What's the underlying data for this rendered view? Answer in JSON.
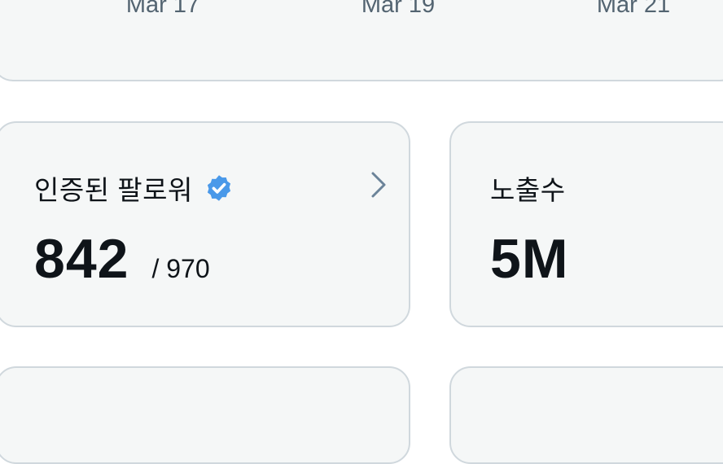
{
  "chart": {
    "x_ticks": [
      "Mar 17",
      "Mar 19",
      "Mar 21"
    ]
  },
  "verified_followers": {
    "label": "인증된 팔로워",
    "value": "842",
    "total": "/ 970",
    "badge_color": "#4a99e9"
  },
  "impressions": {
    "label": "노출수",
    "value": "5M"
  },
  "colors": {
    "card_background": "#f5f7f7",
    "card_border": "#d0d8dd",
    "secondary_text": "#536471",
    "chevron": "#6b8399"
  }
}
